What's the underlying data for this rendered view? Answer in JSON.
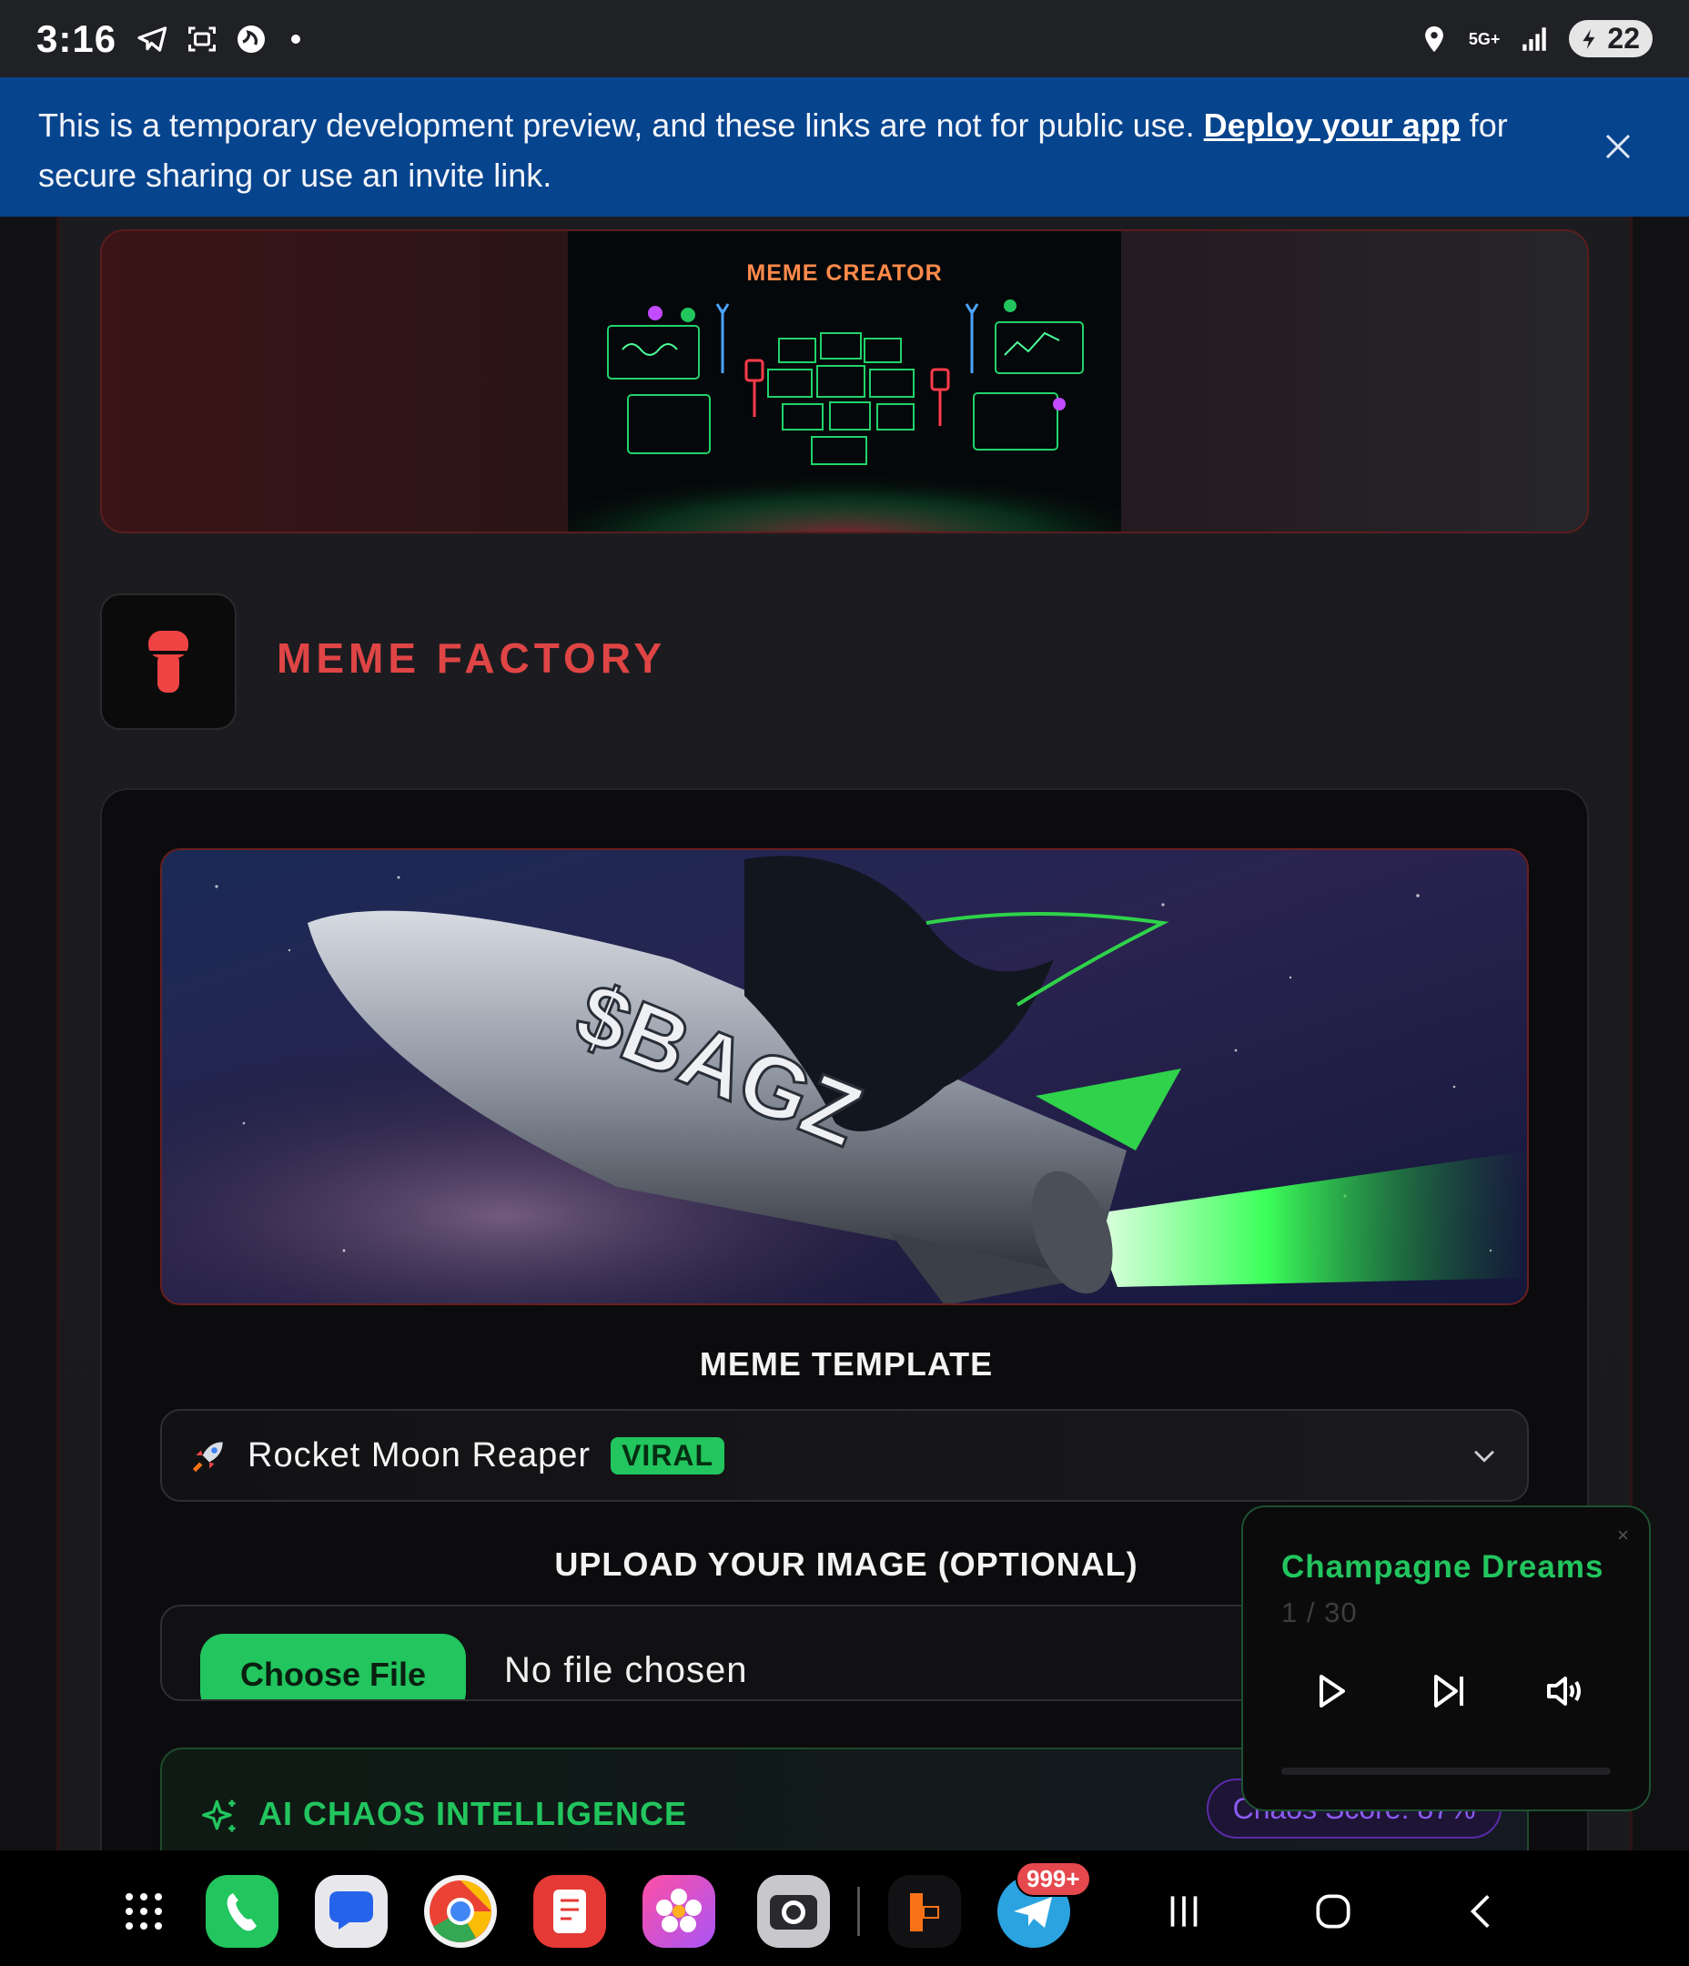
{
  "status_bar": {
    "time": "3:16",
    "network": "5G+",
    "battery": "22"
  },
  "banner": {
    "text_before": "This is a temporary development preview, and these links are not for public use. ",
    "link_text": "Deploy your app",
    "text_after": " for secure sharing or use an invite link."
  },
  "hero": {
    "title": "MEME CREATOR"
  },
  "factory": {
    "title": "MEME FACTORY"
  },
  "meme_image": {
    "caption": "$BAGZ"
  },
  "template": {
    "label": "MEME TEMPLATE",
    "selected": "Rocket Moon Reaper",
    "badge": "VIRAL"
  },
  "upload": {
    "label": "UPLOAD YOUR IMAGE (OPTIONAL)",
    "button": "Choose File",
    "status": "No file chosen"
  },
  "ai": {
    "title": "AI CHAOS INTELLIGENCE",
    "score": "Chaos Score: 87%"
  },
  "player": {
    "title": "Champagne Dreams",
    "track_count": "1 / 30",
    "close": "×"
  },
  "dock": {
    "telegram_badge": "999+"
  },
  "colors": {
    "accent_green": "#22c55e",
    "accent_red": "#e04545",
    "banner_blue": "#07448e"
  }
}
